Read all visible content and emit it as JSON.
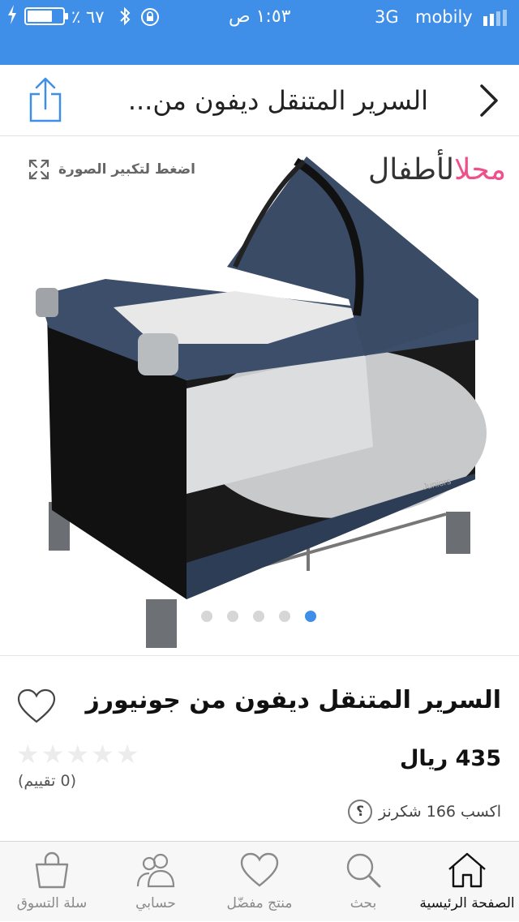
{
  "status_bar": {
    "carrier": "mobily",
    "network": "3G",
    "time": "١:٥٣ ص",
    "battery": "٪ ٦٧"
  },
  "header": {
    "title": "السرير المتنقل ديفون من..."
  },
  "gallery": {
    "zoom_hint": "اضغط لتكبير الصورة",
    "logo": {
      "part1": "محل",
      "part2": "الأطفال"
    },
    "image_brand": "Juniors",
    "page_count": 5,
    "active_page": 1
  },
  "product": {
    "name": "السرير المتنقل ديفون من جونيورز",
    "price": "435 ريال",
    "rating_stars": 0,
    "rating_count": "(0 تقييم)",
    "points": "اكسب 166 شكرنز",
    "points_help": "؟"
  },
  "tabbar": {
    "tabs": [
      {
        "label": "الصفحة الرئيسية",
        "icon": "home-icon",
        "active": true
      },
      {
        "label": "بحث",
        "icon": "search-icon",
        "active": false
      },
      {
        "label": "منتج مفضّل",
        "icon": "heart-icon",
        "active": false
      },
      {
        "label": "حسابي",
        "icon": "users-icon",
        "active": false
      },
      {
        "label": "سلة التسوق",
        "icon": "bag-icon",
        "active": false
      }
    ]
  },
  "colors": {
    "accent": "#3f8ee8",
    "logo_pink": "#ef4f8b",
    "tab_inactive": "#8a8a8a"
  }
}
